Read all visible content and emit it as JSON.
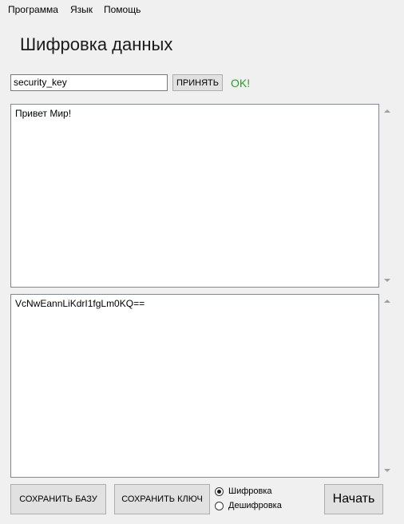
{
  "menu": {
    "items": [
      {
        "label": "Программа"
      },
      {
        "label": "Язык"
      },
      {
        "label": "Помощь"
      }
    ]
  },
  "header": {
    "title": "Шифровка данных"
  },
  "key": {
    "value": "security_key",
    "accept_label": "ПРИНЯТЬ",
    "status": "OK!"
  },
  "input_text": {
    "value": "Привет Мир!"
  },
  "output_text": {
    "value": "VcNwEannLiKdrI1fgLm0KQ=="
  },
  "actions": {
    "save_base_label": "СОХРАНИТЬ БАЗУ",
    "save_key_label": "СОХРАНИТЬ КЛЮЧ",
    "start_label": "Начать"
  },
  "mode": {
    "options": [
      {
        "label": "Шифровка",
        "selected": true
      },
      {
        "label": "Дешифровка",
        "selected": false
      }
    ]
  },
  "colors": {
    "status_ok": "#2e9a2e",
    "background": "#f0f0f0"
  }
}
